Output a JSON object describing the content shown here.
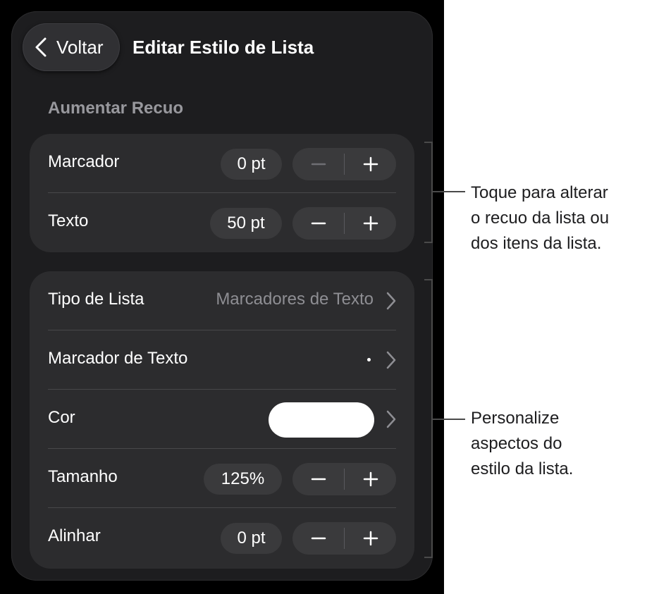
{
  "header": {
    "back_label": "Voltar",
    "title": "Editar Estilo de Lista"
  },
  "indent_section": {
    "title": "Aumentar Recuo",
    "rows": [
      {
        "label": "Marcador",
        "value": "0 pt"
      },
      {
        "label": "Texto",
        "value": "50 pt"
      }
    ]
  },
  "style_section": {
    "list_type": {
      "label": "Tipo de Lista",
      "value": "Marcadores de Texto"
    },
    "bullet": {
      "label": "Marcador de Texto",
      "value": "•"
    },
    "color": {
      "label": "Cor",
      "swatch": "#ffffff"
    },
    "size": {
      "label": "Tamanho",
      "value": "125%"
    },
    "align": {
      "label": "Alinhar",
      "value": "0 pt"
    }
  },
  "stepper_icons": {
    "minus": "minus-icon",
    "plus": "plus-icon"
  },
  "callouts": {
    "indent": [
      "Toque para alterar",
      "o recuo da lista ou",
      "dos itens da lista."
    ],
    "style": [
      "Personalize",
      "aspectos do",
      "estilo da lista."
    ]
  },
  "colors": {
    "background": "#1d1d1f",
    "group": "#2c2c2e",
    "control": "#3a3a3c",
    "secondary_text": "#8e8e93",
    "disabled": "#6e6e73"
  }
}
